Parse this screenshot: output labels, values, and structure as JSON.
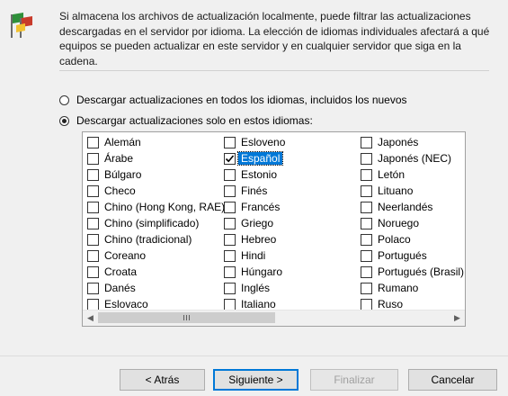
{
  "description": "Si almacena los archivos de actualización localmente, puede filtrar las actualizaciones descargadas en el servidor por idioma. La elección de idiomas individuales afectará a qué equipos se pueden actualizar en este servidor y en cualquier servidor que siga en la cadena.",
  "language_options": {
    "all": {
      "label": "Descargar actualizaciones en todos los idiomas, incluidos los nuevos",
      "selected": false
    },
    "only": {
      "label": "Descargar actualizaciones solo en estos idiomas:",
      "selected": true
    }
  },
  "languages": {
    "col1": [
      {
        "label": "Alemán",
        "checked": false
      },
      {
        "label": "Árabe",
        "checked": false
      },
      {
        "label": "Búlgaro",
        "checked": false
      },
      {
        "label": "Checo",
        "checked": false
      },
      {
        "label": "Chino (Hong Kong, RAE)",
        "checked": false
      },
      {
        "label": "Chino (simplificado)",
        "checked": false
      },
      {
        "label": "Chino (tradicional)",
        "checked": false
      },
      {
        "label": "Coreano",
        "checked": false
      },
      {
        "label": "Croata",
        "checked": false
      },
      {
        "label": "Danés",
        "checked": false
      },
      {
        "label": "Eslovaco",
        "checked": false
      }
    ],
    "col2": [
      {
        "label": "Esloveno",
        "checked": false
      },
      {
        "label": "Español",
        "checked": true
      },
      {
        "label": "Estonio",
        "checked": false
      },
      {
        "label": "Finés",
        "checked": false
      },
      {
        "label": "Francés",
        "checked": false
      },
      {
        "label": "Griego",
        "checked": false
      },
      {
        "label": "Hebreo",
        "checked": false
      },
      {
        "label": "Hindi",
        "checked": false
      },
      {
        "label": "Húngaro",
        "checked": false
      },
      {
        "label": "Inglés",
        "checked": false
      },
      {
        "label": "Italiano",
        "checked": false
      }
    ],
    "col3": [
      {
        "label": "Japonés",
        "checked": false
      },
      {
        "label": "Japonés (NEC)",
        "checked": false
      },
      {
        "label": "Letón",
        "checked": false
      },
      {
        "label": "Lituano",
        "checked": false
      },
      {
        "label": "Neerlandés",
        "checked": false
      },
      {
        "label": "Noruego",
        "checked": false
      },
      {
        "label": "Polaco",
        "checked": false
      },
      {
        "label": "Portugués",
        "checked": false
      },
      {
        "label": "Portugués (Brasil)",
        "checked": false
      },
      {
        "label": "Rumano",
        "checked": false
      },
      {
        "label": "Ruso",
        "checked": false
      }
    ]
  },
  "selected_language": "Español",
  "buttons": {
    "back": "< Atrás",
    "next": "Siguiente >",
    "finish": "Finalizar",
    "cancel": "Cancelar"
  },
  "colors": {
    "accent": "#0078d7",
    "background": "#f0f0f0"
  },
  "icons": {
    "top": "wsus-flags-icon",
    "scroll_left": "scroll-left-arrow-icon",
    "scroll_right": "scroll-right-arrow-icon"
  }
}
